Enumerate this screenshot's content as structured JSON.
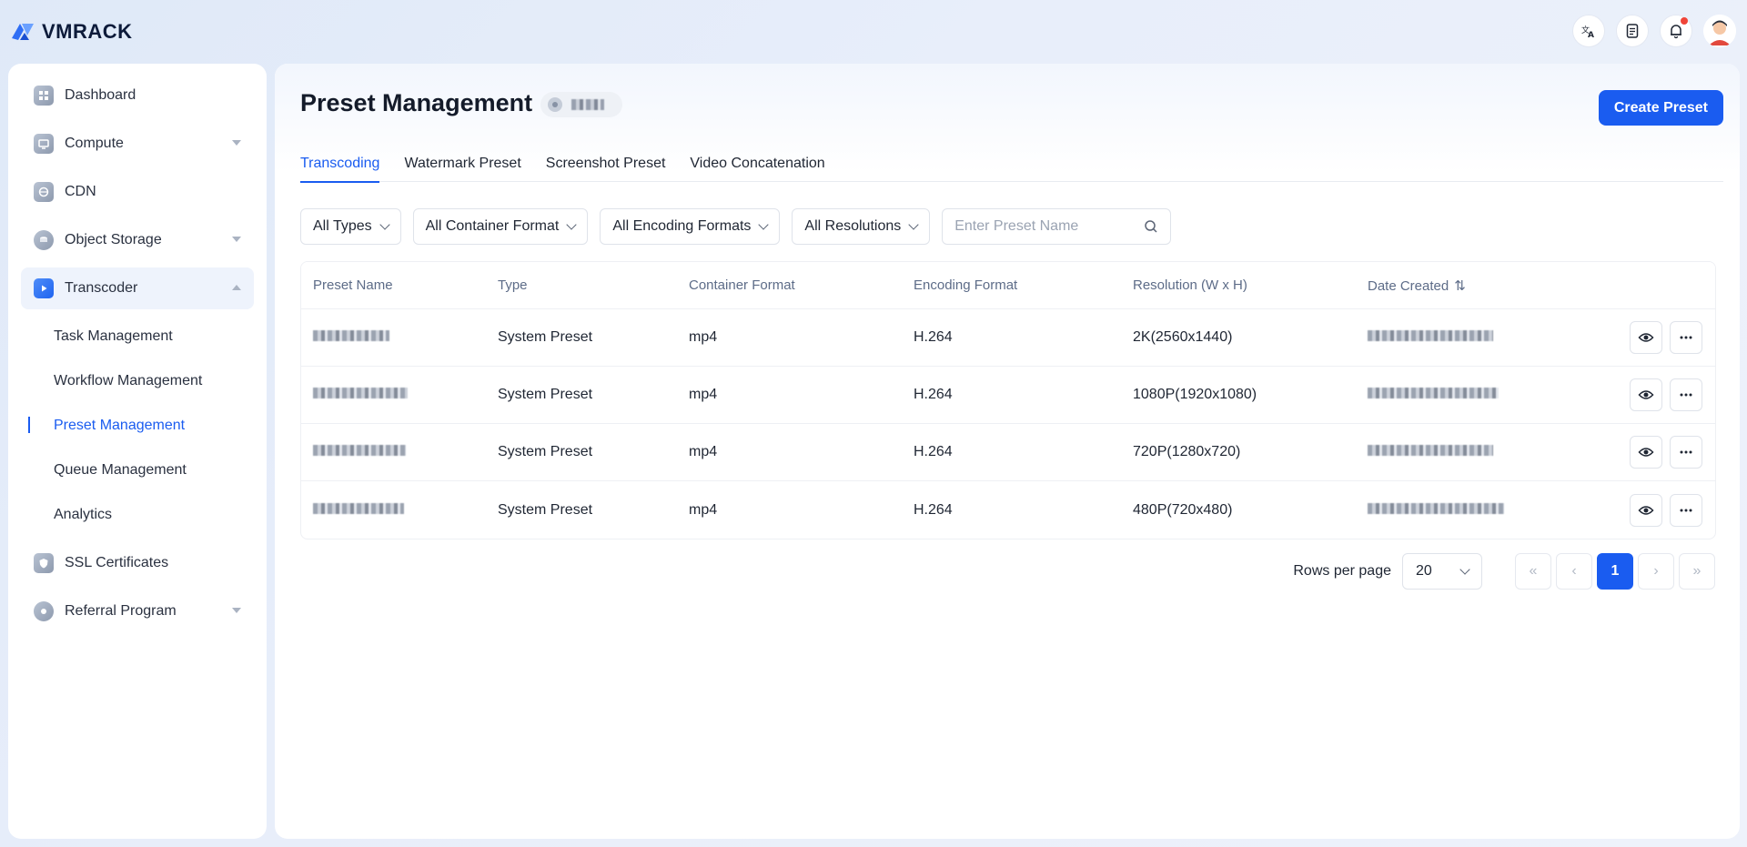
{
  "app": {
    "brand": "VMRACK"
  },
  "topbar": {
    "icons": [
      "translate-icon",
      "document-icon",
      "bell-icon",
      "user-avatar"
    ]
  },
  "sidebar": {
    "items": [
      {
        "label": "Dashboard",
        "icon": "dashboard-icon"
      },
      {
        "label": "Compute",
        "icon": "compute-icon",
        "expandable": true
      },
      {
        "label": "CDN",
        "icon": "cdn-icon"
      },
      {
        "label": "Object Storage",
        "icon": "storage-icon",
        "expandable": true
      },
      {
        "label": "Transcoder",
        "icon": "transcoder-icon",
        "expanded": true,
        "active": true
      },
      {
        "label": "SSL Certificates",
        "icon": "shield-icon"
      },
      {
        "label": "Referral Program",
        "icon": "referral-icon",
        "expandable": true
      }
    ],
    "transcoder_sub": [
      {
        "label": "Task Management"
      },
      {
        "label": "Workflow Management"
      },
      {
        "label": "Preset Management",
        "active": true
      },
      {
        "label": "Queue Management"
      },
      {
        "label": "Analytics"
      }
    ]
  },
  "main": {
    "title": "Preset Management",
    "create_label": "Create Preset",
    "tabs": [
      {
        "label": "Transcoding",
        "active": true
      },
      {
        "label": "Watermark Preset"
      },
      {
        "label": "Screenshot Preset"
      },
      {
        "label": "Video Concatenation"
      }
    ],
    "filters": {
      "type": "All Types",
      "container": "All Container Format",
      "encoding": "All Encoding Formats",
      "resolution": "All Resolutions",
      "search_placeholder": "Enter Preset Name"
    },
    "table": {
      "headers": [
        "Preset Name",
        "Type",
        "Container Format",
        "Encoding Format",
        "Resolution (W x H)",
        "Date Created"
      ],
      "rows": [
        {
          "type": "System Preset",
          "container": "mp4",
          "encoding": "H.264",
          "resolution": "2K(2560x1440)"
        },
        {
          "type": "System Preset",
          "container": "mp4",
          "encoding": "H.264",
          "resolution": "1080P(1920x1080)"
        },
        {
          "type": "System Preset",
          "container": "mp4",
          "encoding": "H.264",
          "resolution": "720P(1280x720)"
        },
        {
          "type": "System Preset",
          "container": "mp4",
          "encoding": "H.264",
          "resolution": "480P(720x480)"
        }
      ]
    },
    "pagination": {
      "rows_label": "Rows per page",
      "rows_value": "20",
      "current_page": "1"
    }
  },
  "colors": {
    "accent": "#1a5cf0",
    "notification": "#f04438"
  }
}
